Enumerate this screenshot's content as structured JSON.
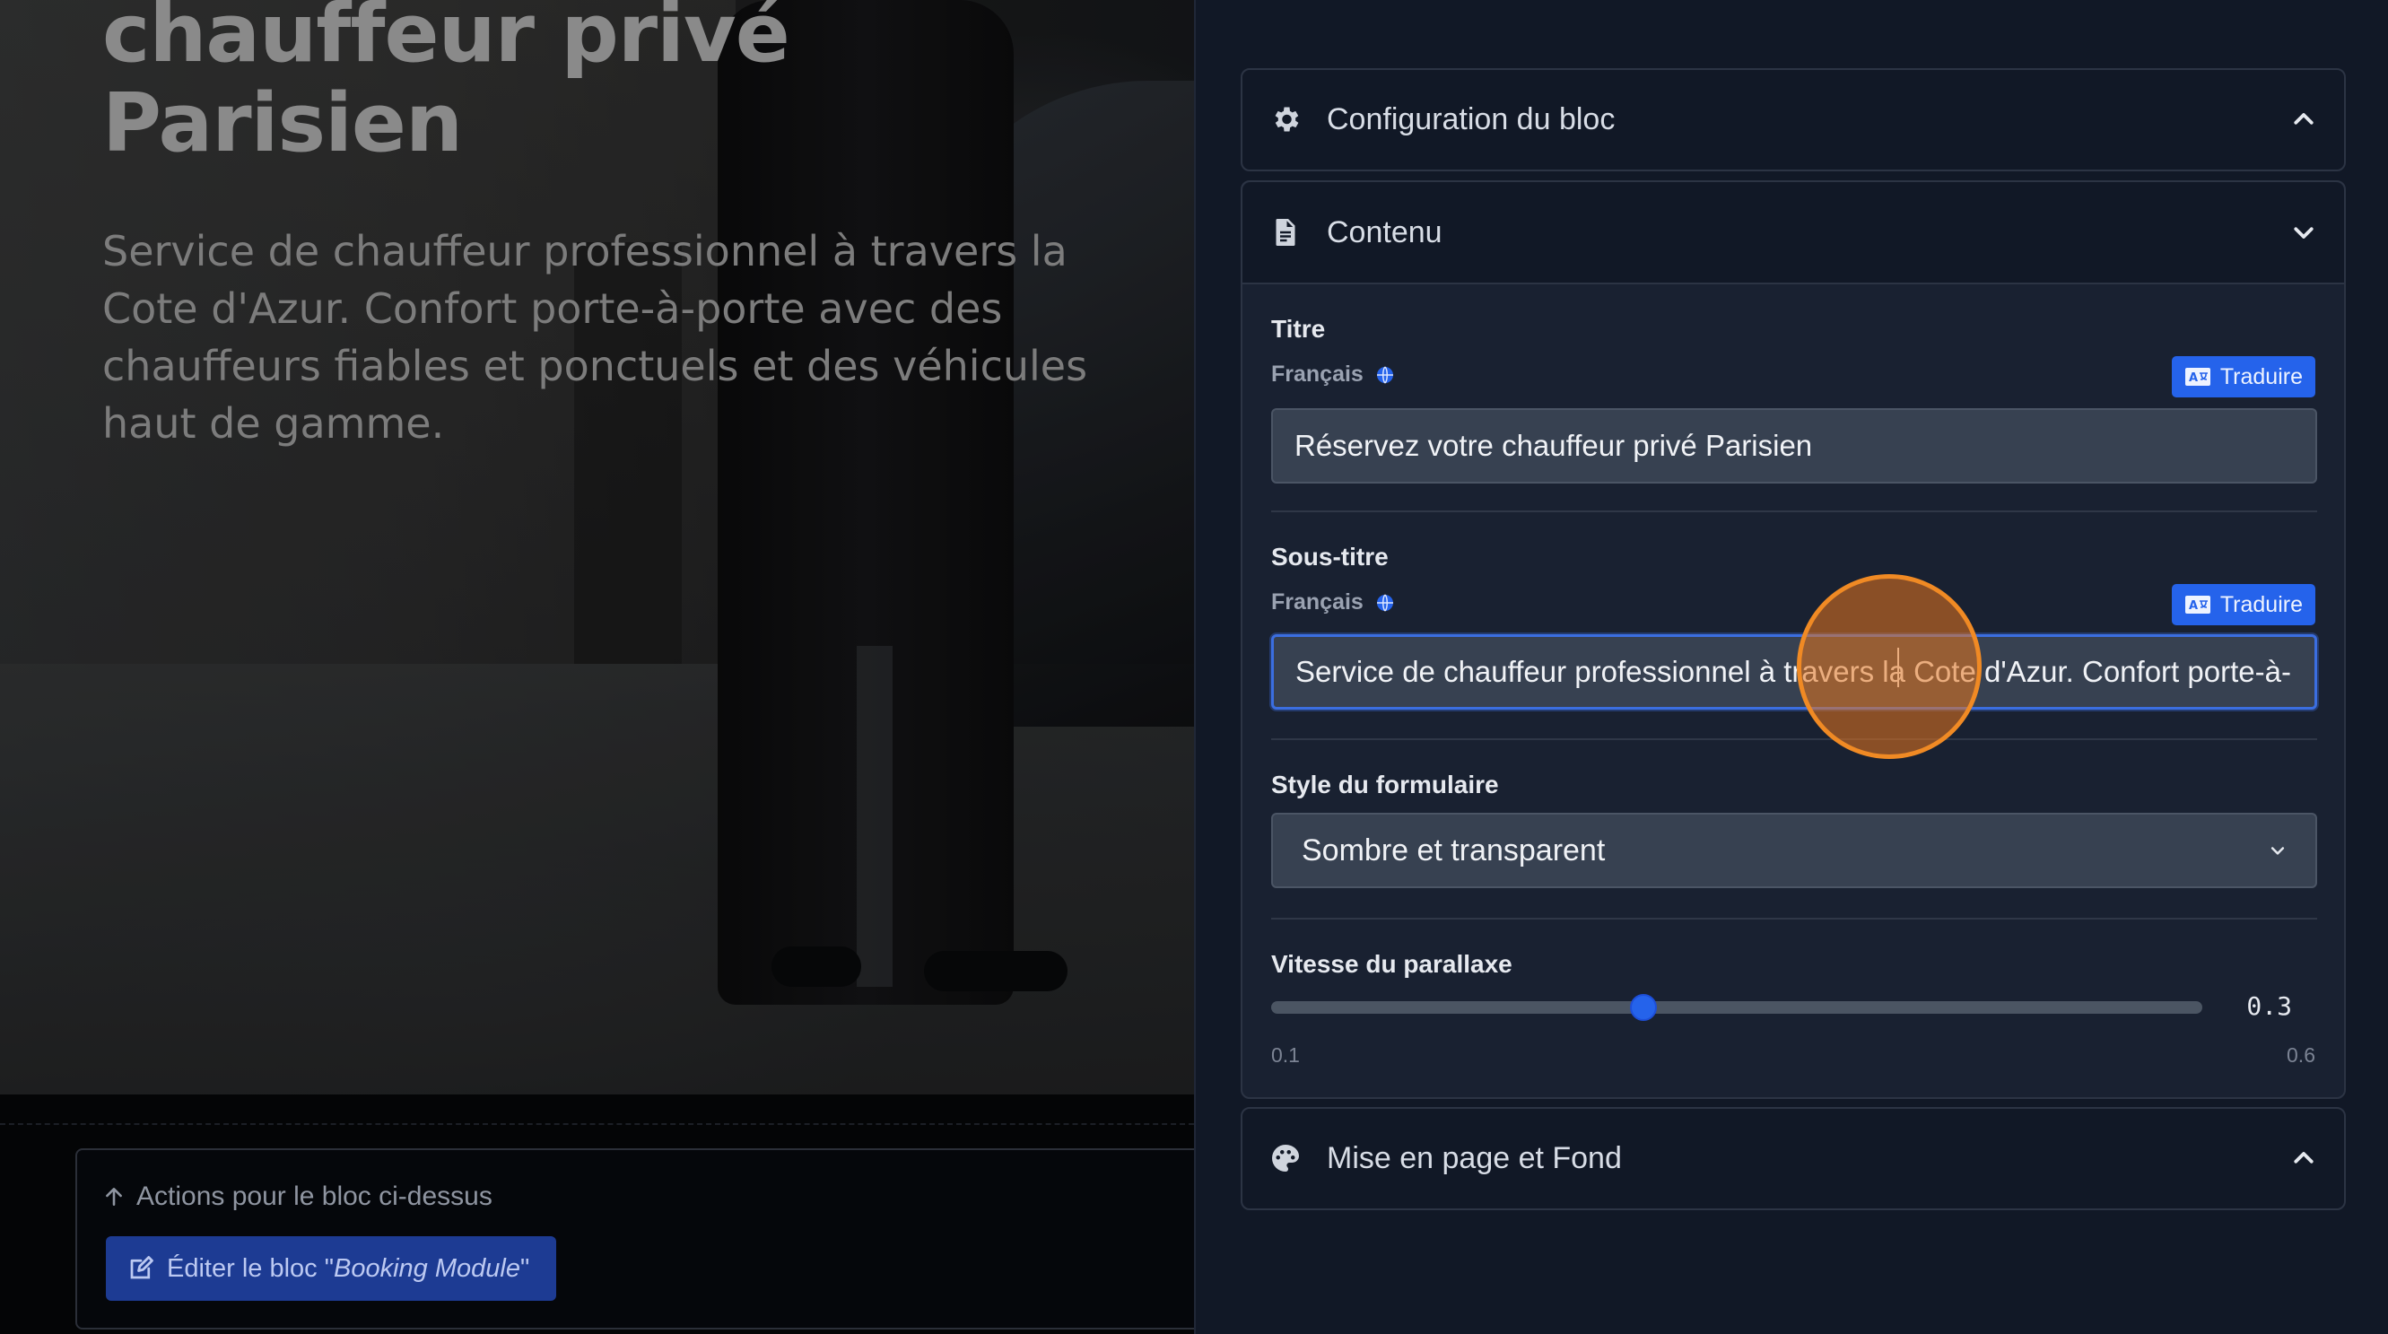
{
  "preview": {
    "hero_title": "chauffeur privé Parisien",
    "hero_subtitle": "Service de chauffeur professionnel à travers la Cote d'Azur. Confort porte-à-porte avec des chauffeurs fiables et ponctuels et des véhicules haut de gamme.",
    "actions_label": "Actions pour le bloc ci-dessus",
    "edit_button_prefix": "Éditer le bloc \"",
    "edit_button_block_name": "Booking Module",
    "edit_button_suffix": "\""
  },
  "panel": {
    "config_section": {
      "label": "Configuration du bloc",
      "icon": "gear-icon",
      "state": "collapsed"
    },
    "content_section": {
      "label": "Contenu",
      "icon": "document-icon",
      "state": "expanded",
      "title_field": {
        "label": "Titre",
        "language": "Français",
        "translate_label": "Traduire",
        "value": "Réservez votre chauffeur privé Parisien"
      },
      "subtitle_field": {
        "label": "Sous-titre",
        "language": "Français",
        "translate_label": "Traduire",
        "value": "Service de chauffeur professionnel à travers la Cote d'Azur. Confort porte-à-porte avec des chauffeurs fiables et ponctuels et des véhicules haut de gamme."
      },
      "form_style_field": {
        "label": "Style du formulaire",
        "selected": "Sombre et transparent"
      },
      "parallax_field": {
        "label": "Vitesse du parallaxe",
        "value": 0.3,
        "value_text": "0.3",
        "min": 0.1,
        "min_text": "0.1",
        "max": 0.6,
        "max_text": "0.6"
      }
    },
    "layout_section": {
      "label": "Mise en page et Fond",
      "icon": "palette-icon",
      "state": "collapsed"
    }
  },
  "colors": {
    "accent": "#2563eb",
    "click_indicator": "#f08a24",
    "panel_bg": "#111826"
  }
}
